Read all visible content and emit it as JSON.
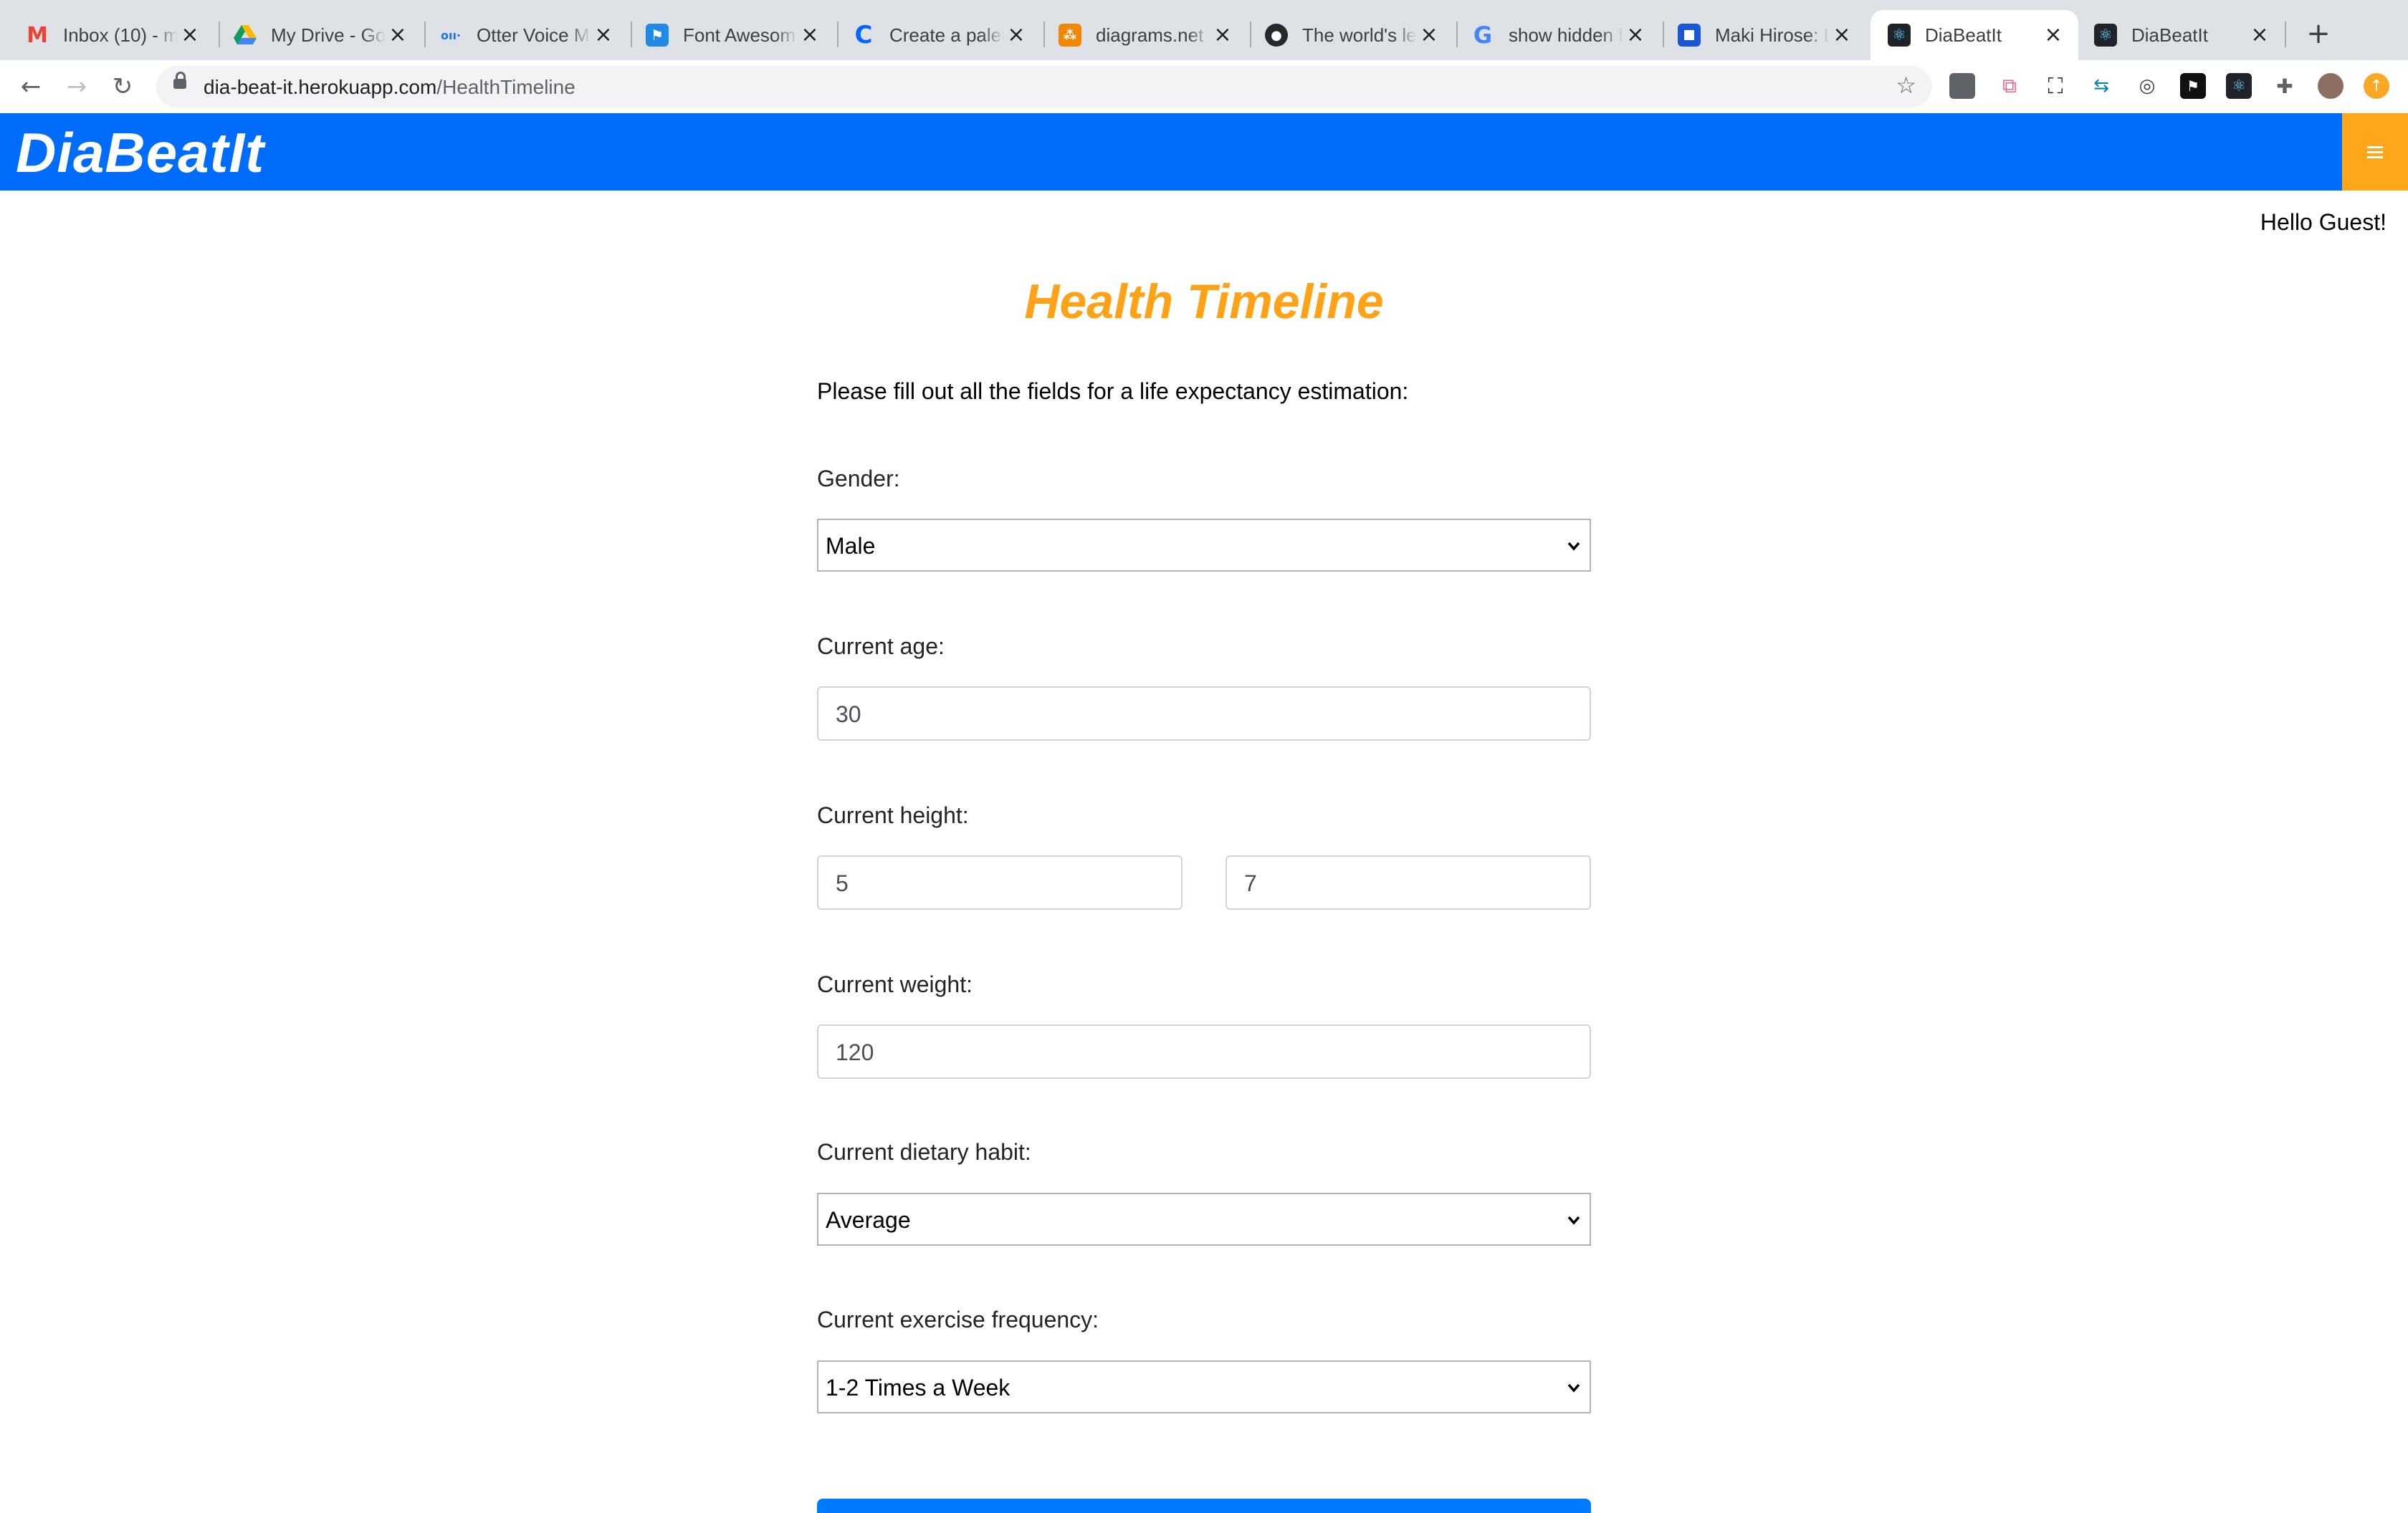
{
  "browser": {
    "tabs": [
      {
        "title": "Inbox (10) - m",
        "favicon": "gmail-icon",
        "color": "#ea4335",
        "active": false
      },
      {
        "title": "My Drive - Go",
        "favicon": "drive-icon",
        "color": "#1fa463",
        "active": false
      },
      {
        "title": "Otter Voice M",
        "favicon": "otter-icon",
        "color": "#1a73e8",
        "active": false
      },
      {
        "title": "Font Awesom",
        "favicon": "flag-icon",
        "color": "#228ae6",
        "active": false
      },
      {
        "title": "Create a palet",
        "favicon": "coolors-icon",
        "color": "#0066ff",
        "active": false
      },
      {
        "title": "diagrams.net",
        "favicon": "diagrams-icon",
        "color": "#f08705",
        "active": false
      },
      {
        "title": "The world's le",
        "favicon": "github-icon",
        "color": "#24292e",
        "active": false
      },
      {
        "title": "show hidden f",
        "favicon": "google-icon",
        "color": "#4285f4",
        "active": false
      },
      {
        "title": "Maki Hirose: L",
        "favicon": "square-icon",
        "color": "#1a57d6",
        "active": false
      },
      {
        "title": "DiaBeatIt",
        "favicon": "react-icon",
        "color": "#20232a",
        "active": true
      },
      {
        "title": "DiaBeatIt",
        "favicon": "react-icon",
        "color": "#20232a",
        "active": false
      }
    ],
    "url_host": "dia-beat-it.herokuapp.com",
    "url_path": "/HealthTimeline"
  },
  "app": {
    "brand": "DiaBeatIt",
    "primary_color": "#006cfc",
    "accent_color": "#ffa61b",
    "greeting": "Hello Guest!"
  },
  "page": {
    "title": "Health Timeline",
    "intro": "Please fill out all the fields for a life expectancy estimation:"
  },
  "form": {
    "gender": {
      "label": "Gender:",
      "value": "Male"
    },
    "age": {
      "label": "Current age:",
      "value": "30"
    },
    "height": {
      "label": "Current height:",
      "feet": "5",
      "inches": "7"
    },
    "weight": {
      "label": "Current weight:",
      "value": "120"
    },
    "diet": {
      "label": "Current dietary habit:",
      "value": "Average"
    },
    "exercise": {
      "label": "Current exercise frequency:",
      "value": "1-2 Times a Week"
    }
  }
}
